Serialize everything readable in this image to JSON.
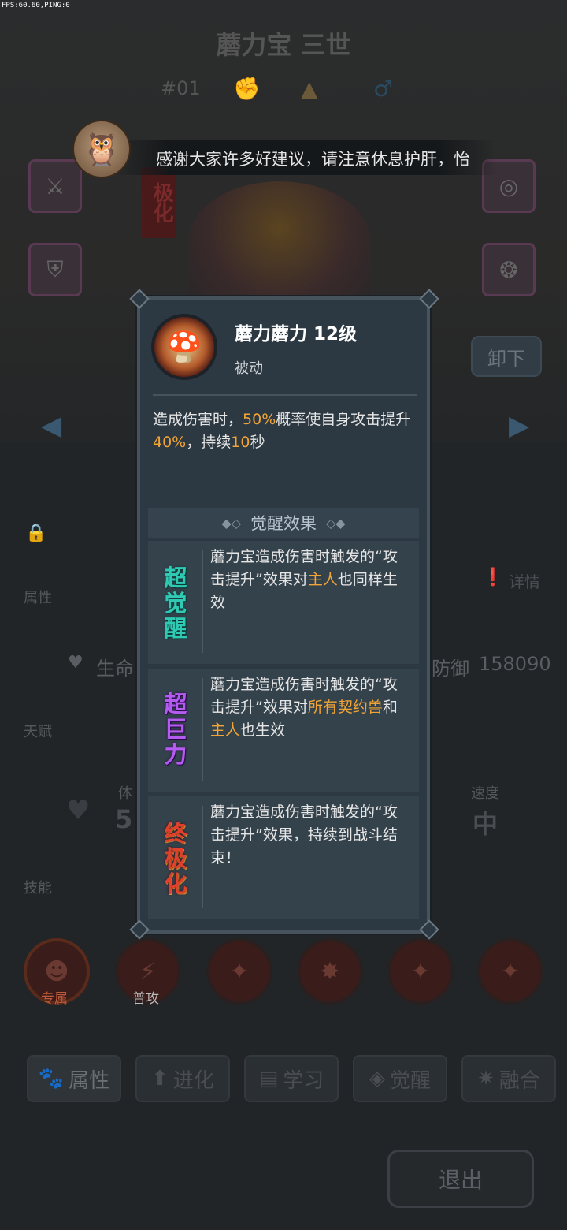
{
  "fps": "FPS:60.60,PING:0",
  "pet": {
    "title": "蘑力宝 三世",
    "number": "#01"
  },
  "notice": "感谢大家许多好建议，请注意休息护肝，怡",
  "background": {
    "unequip": "卸下",
    "attr_label": "属性",
    "details": "详情",
    "life": "生命",
    "defense": "防御",
    "defense_value": "158090",
    "talent_label": "天赋",
    "stat_left_label": "体",
    "stat_left_value": "5.",
    "speed_label": "速度",
    "speed_value": "中",
    "skills_label": "技能",
    "skill_exclusive": "专属",
    "skill_normal": "普攻",
    "tabs": [
      "属性",
      "进化",
      "学习",
      "觉醒",
      "融合"
    ],
    "exit": "退出"
  },
  "popup": {
    "skill_name": "蘑力蘑力 12级",
    "skill_type": "被动",
    "desc": {
      "p1": "造成伤害时，",
      "pct1": "50%",
      "p2": "概率使自身攻击提升",
      "pct2": "40%",
      "p3": "，持续",
      "dur": "10",
      "p4": "秒"
    },
    "awaken_header": "觉醒效果",
    "cards": [
      {
        "badge": [
          "超",
          "觉",
          "醒"
        ],
        "t1": "蘑力宝造成伤害时触发的“攻击提升”效果对",
        "h1": "主人",
        "t2": "也同样生效"
      },
      {
        "badge": [
          "超",
          "巨",
          "力"
        ],
        "t1": "蘑力宝造成伤害时触发的“攻击提升”效果对",
        "h1": "所有契约兽",
        "t2": "和",
        "h2": "主人",
        "t3": "也生效"
      },
      {
        "badge": [
          "终",
          "极",
          "化"
        ],
        "t1": "蘑力宝造成伤害时触发的“攻击提升”效果，持续到战斗结束！"
      }
    ]
  },
  "colors": {
    "highlight": "#f2a535",
    "popup_bg": "#2c3842",
    "card_bg": "#34424c",
    "badge_teal": "#2fc9b4",
    "badge_purple": "#b45cf0",
    "badge_red": "#e0402c"
  }
}
